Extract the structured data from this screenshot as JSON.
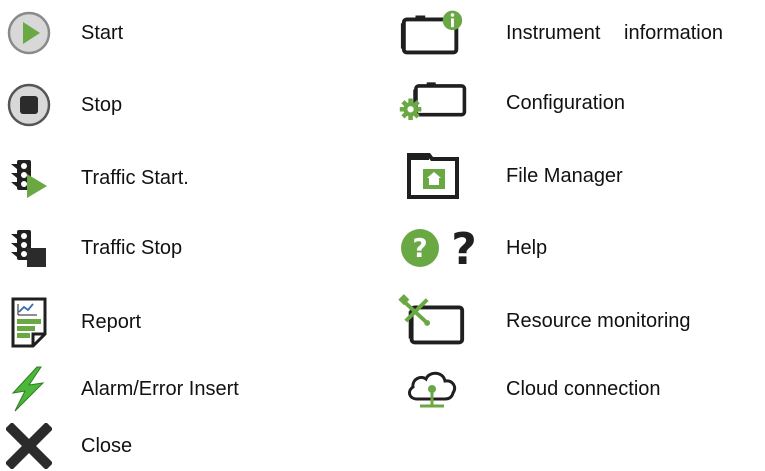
{
  "left_column": [
    {
      "icon": "play-circle-icon",
      "label": "Start"
    },
    {
      "icon": "stop-circle-icon",
      "label": "Stop"
    },
    {
      "icon": "traffic-light-play-icon",
      "label": "Traffic Start."
    },
    {
      "icon": "traffic-light-stop-icon",
      "label": "Traffic Stop"
    },
    {
      "icon": "report-icon",
      "label": "Report"
    },
    {
      "icon": "lightning-bolt-icon",
      "label": "Alarm/Error Insert"
    },
    {
      "icon": "close-x-icon",
      "label": "Close"
    }
  ],
  "right_column": [
    {
      "icon": "tablet-info-icon",
      "label": "Instrument information"
    },
    {
      "icon": "tablet-gear-icon",
      "label": "Configuration"
    },
    {
      "icon": "folder-home-icon",
      "label": "File Manager"
    },
    {
      "icon": "help-question-icon",
      "label": "Help"
    },
    {
      "icon": "tablet-tools-icon",
      "label": "Resource monitoring"
    },
    {
      "icon": "cloud-connection-icon",
      "label": "Cloud connection"
    }
  ],
  "colors": {
    "accent_green": "#6aa844",
    "dark": "#1f1f1f",
    "gray": "#8a8a8a"
  }
}
